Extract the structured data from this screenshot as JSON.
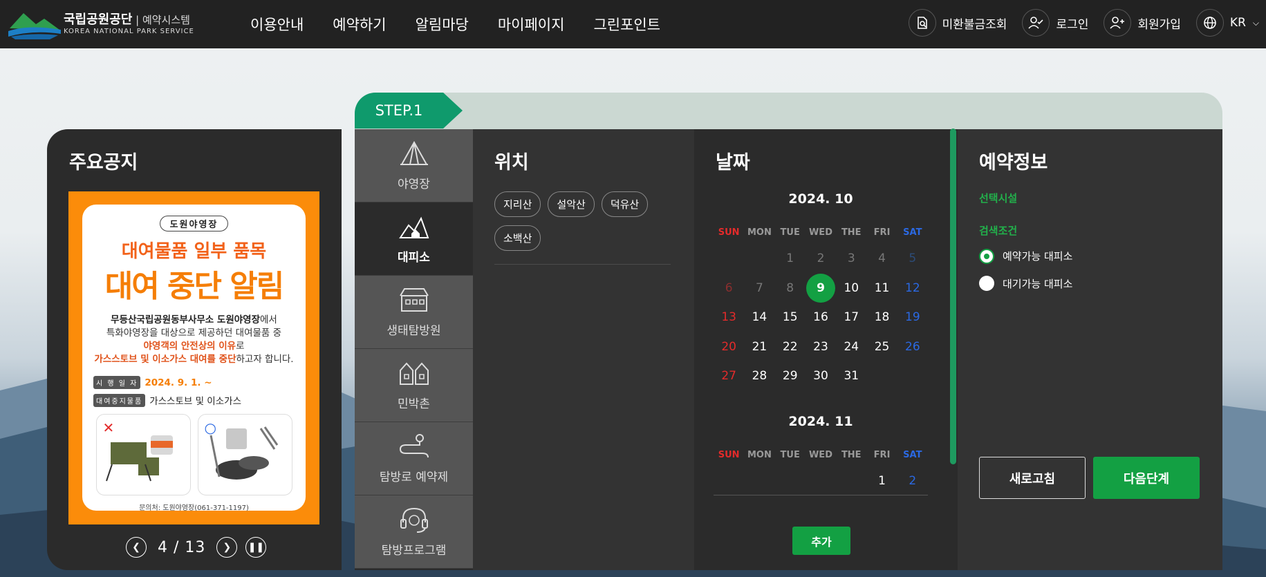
{
  "header": {
    "logo_ko": "국립공원공단",
    "logo_sys": "예약시스템",
    "logo_en": "KOREA NATIONAL PARK SERVICE",
    "nav": [
      "이용안내",
      "예약하기",
      "알림마당",
      "마이페이지",
      "그린포인트"
    ],
    "util": {
      "refund": "미환불금조회",
      "login": "로그인",
      "signup": "회원가입",
      "lang": "KR"
    }
  },
  "notice": {
    "title": "주요공지",
    "poster": {
      "tag": "도원야영장",
      "headline1": "대여물품 일부 품목",
      "headline2": "대여 중단 알림",
      "body_bold": "무등산국립공원동부사무소 도원야영장",
      "body_1_rest": "에서",
      "body_2": "특화야영장을 대상으로 제공하던 대여물품 중",
      "body_3_em": "야영객의 안전상의 이유",
      "body_3_rest": "로",
      "body_4_em": "가스스토브 및 이소가스 대여를 중단",
      "body_4_rest": "하고자 합니다.",
      "date_label": "시 행 일 자",
      "date_value": "2024. 9. 1. ~",
      "items_label": "대여중지물품",
      "items_value": "가스스토브 및 이소가스",
      "mark_no": "✕",
      "mark_ok": "○",
      "contact": "문의처: 도원야영장(061-371-1197)"
    },
    "pager": {
      "current": "4",
      "sep": "/",
      "total": "13"
    }
  },
  "step": {
    "label": "STEP.1"
  },
  "categories": [
    {
      "label": "야영장",
      "icon": "tent-icon",
      "active": false
    },
    {
      "label": "대피소",
      "icon": "shelter-icon",
      "active": true
    },
    {
      "label": "생태탐방원",
      "icon": "building-icon",
      "active": false
    },
    {
      "label": "민박촌",
      "icon": "houses-icon",
      "active": false
    },
    {
      "label": "탐방로 예약제",
      "icon": "trail-icon",
      "active": false
    },
    {
      "label": "탐방프로그램",
      "icon": "headset-icon",
      "active": false
    }
  ],
  "location": {
    "title": "위치",
    "chips": [
      "지리산",
      "설악산",
      "덕유산",
      "소백산"
    ]
  },
  "date": {
    "title": "날짜",
    "weekdays": [
      "SUN",
      "MON",
      "TUE",
      "WED",
      "THE",
      "FRI",
      "SAT"
    ],
    "month1": {
      "label": "2024. 10",
      "weeks": [
        [
          "",
          "",
          "1",
          "2",
          "3",
          "4",
          "5"
        ],
        [
          "6",
          "7",
          "8",
          "9",
          "10",
          "11",
          "12"
        ],
        [
          "13",
          "14",
          "15",
          "16",
          "17",
          "18",
          "19"
        ],
        [
          "20",
          "21",
          "22",
          "23",
          "24",
          "25",
          "26"
        ],
        [
          "27",
          "28",
          "29",
          "30",
          "31",
          "",
          ""
        ]
      ],
      "selected": "9"
    },
    "month2": {
      "label": "2024. 11",
      "weeks": [
        [
          "",
          "",
          "",
          "",
          "",
          "1",
          "2"
        ]
      ]
    },
    "add_label": "추가"
  },
  "info": {
    "title": "예약정보",
    "facility_label": "선택시설",
    "condition_label": "검색조건",
    "options": [
      {
        "label": "예약가능 대피소",
        "checked": true
      },
      {
        "label": "대기가능 대피소",
        "checked": false
      }
    ],
    "refresh_label": "새로고침",
    "next_label": "다음단계"
  },
  "colors": {
    "header": "#222222",
    "accent": "#13a043",
    "step": "#0f9a6c",
    "panel": "#2b2b2b",
    "sun": "#e32b2b",
    "sat": "#2b69e3"
  }
}
